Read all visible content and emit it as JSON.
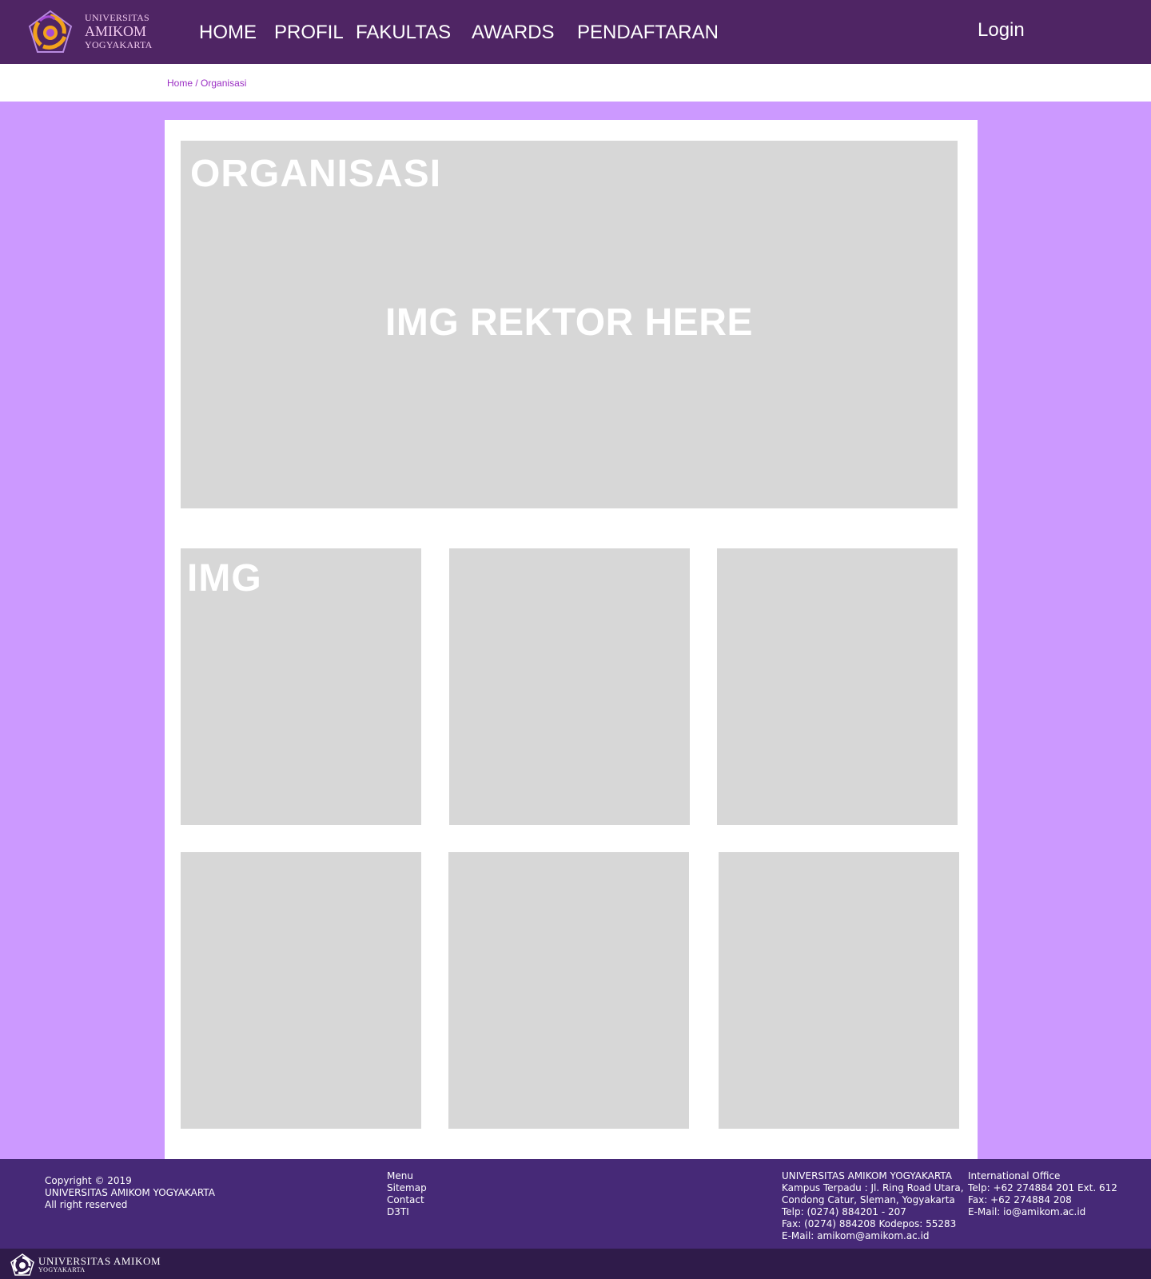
{
  "header": {
    "logo": {
      "line1": "UNIVERSITAS",
      "line2": "AMIKOM",
      "line3": "YOGYAKARTA"
    },
    "nav": [
      {
        "label": "HOME"
      },
      {
        "label": "PROFIL"
      },
      {
        "label": "FAKULTAS"
      },
      {
        "label": "AWARDS"
      },
      {
        "label": "PENDAFTARAN"
      }
    ],
    "login_label": "Login"
  },
  "breadcrumb": {
    "home": "Home",
    "separator": "/",
    "current": "Organisasi"
  },
  "main": {
    "title": "ORGANISASI",
    "hero_placeholder": "IMG REKTOR HERE",
    "tile_label": "IMG"
  },
  "footer": {
    "copyright": {
      "line1": "Copyright © 2019",
      "line2": "UNIVERSITAS AMIKOM YOGYAKARTA",
      "line3": "All right reserved"
    },
    "links": [
      "Menu",
      "Sitemap",
      "Contact",
      "D3TI"
    ],
    "address": {
      "line1": "UNIVERSITAS AMIKOM YOGYAKARTA",
      "line2": "Kampus Terpadu : Jl. Ring Road Utara,",
      "line3": "Condong Catur, Sleman, Yogyakarta",
      "line4": "Telp: (0274) 884201 - 207",
      "line5": "Fax: (0274) 884208 Kodepos: 55283",
      "line6": "E-Mail: amikom@amikom.ac.id"
    },
    "international": {
      "line1": "International Office",
      "line2": "Telp: +62 274884 201 Ext. 612",
      "line3": "Fax: +62 274884 208",
      "line4": "E-Mail: io@amikom.ac.id"
    },
    "bottom_logo": {
      "line1": "UNIVERSITAS AMIKOM",
      "line2": "YOGYAKARTA"
    }
  },
  "colors": {
    "header_bg": "#4f2564",
    "page_bg": "#cc99ff",
    "footer_bg": "#462977",
    "footer_bottom_bg": "#2f1b4a",
    "placeholder_gray": "#d7d7d7",
    "link_purple": "#9b2fc4"
  }
}
